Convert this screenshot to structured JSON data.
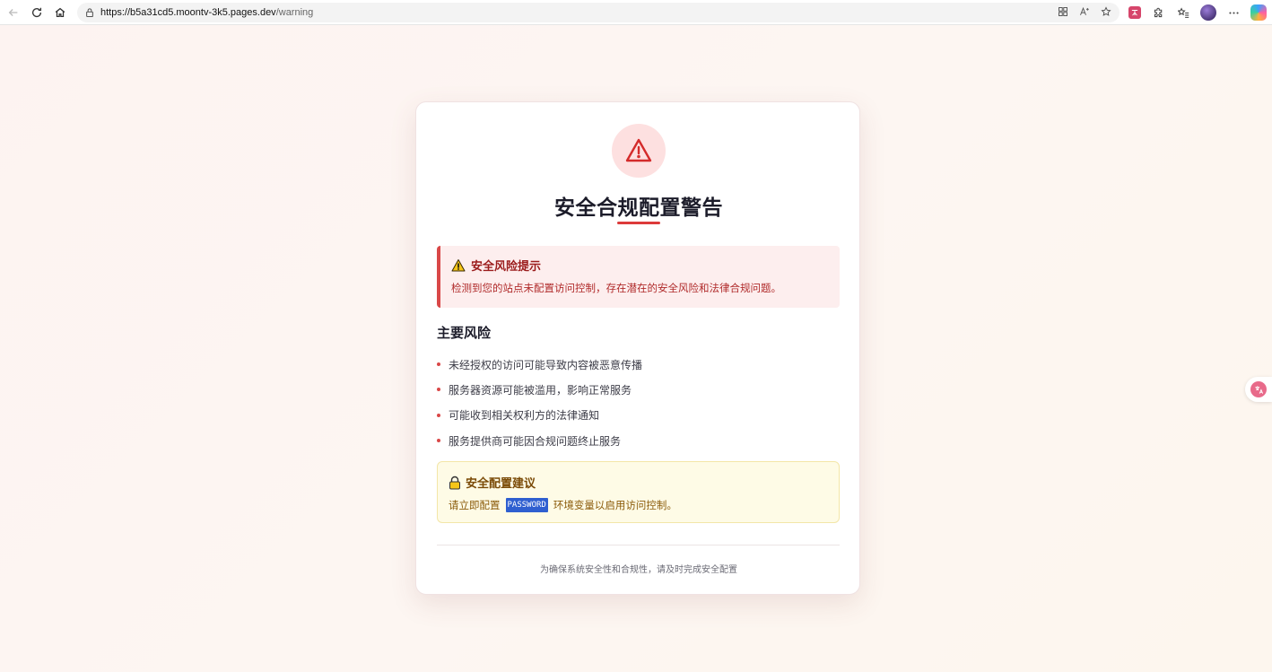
{
  "browser": {
    "url_host": "https://b5a31cd5.moontv-3k5.pages.dev",
    "url_path": "/warning"
  },
  "card": {
    "title": "安全合规配置警告",
    "alert": {
      "title": "安全风险提示",
      "text": "检测到您的站点未配置访问控制，存在潜在的安全风险和法律合规问题。"
    },
    "risks": {
      "title": "主要风险",
      "items": [
        "未经授权的访问可能导致内容被恶意传播",
        "服务器资源可能被滥用，影响正常服务",
        "可能收到相关权利方的法律通知",
        "服务提供商可能因合规问题终止服务"
      ]
    },
    "suggestion": {
      "title": "安全配置建议",
      "text_before": "请立即配置",
      "code": "PASSWORD",
      "text_after": "环境变量以启用访问控制。"
    },
    "footer": "为确保系统安全性和合规性，请及时完成安全配置"
  },
  "colors": {
    "danger": "#d94848",
    "warning_bg": "#fefbe6",
    "code_bg": "#2f5fd0"
  }
}
